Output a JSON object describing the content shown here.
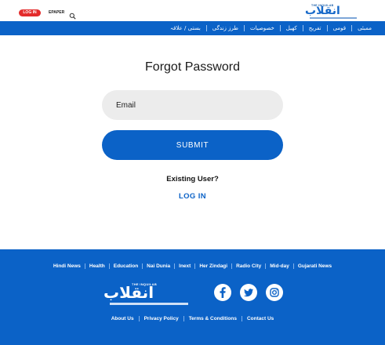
{
  "header": {
    "login_label": "LOG IN",
    "epaper_label": "EPAPER",
    "search_icon": "search-icon",
    "logo_en": "THE INQUILAB",
    "logo_ur": "انقلاب",
    "nav_items": [
      "ممبئی",
      "قومی",
      "تفریح",
      "کھیل",
      "خصوصیات",
      "طرز زندگی",
      "بستی / علاقہ"
    ]
  },
  "form": {
    "title": "Forgot Password",
    "email_placeholder": "Email",
    "submit_label": "SUBMIT",
    "existing_user_text": "Existing User?",
    "login_link": "LOG IN"
  },
  "footer": {
    "links": [
      "Hindi News",
      "Health",
      "Education",
      "Nai Dunia",
      "Inext",
      "Her Zindagi",
      "Radio City",
      "Mid-day",
      "Gujarati News"
    ],
    "logo_en": "THE INQUILAB",
    "logo_ur": "انقلاب",
    "social": [
      "facebook-icon",
      "twitter-icon",
      "instagram-icon"
    ],
    "bottom_links": [
      "About Us",
      "Privacy Policy",
      "Terms & Conditions",
      "Contact Us"
    ]
  },
  "colors": {
    "brand_blue": "#0b62c7",
    "login_red": "#e32c2c",
    "input_bg": "#ececec"
  }
}
